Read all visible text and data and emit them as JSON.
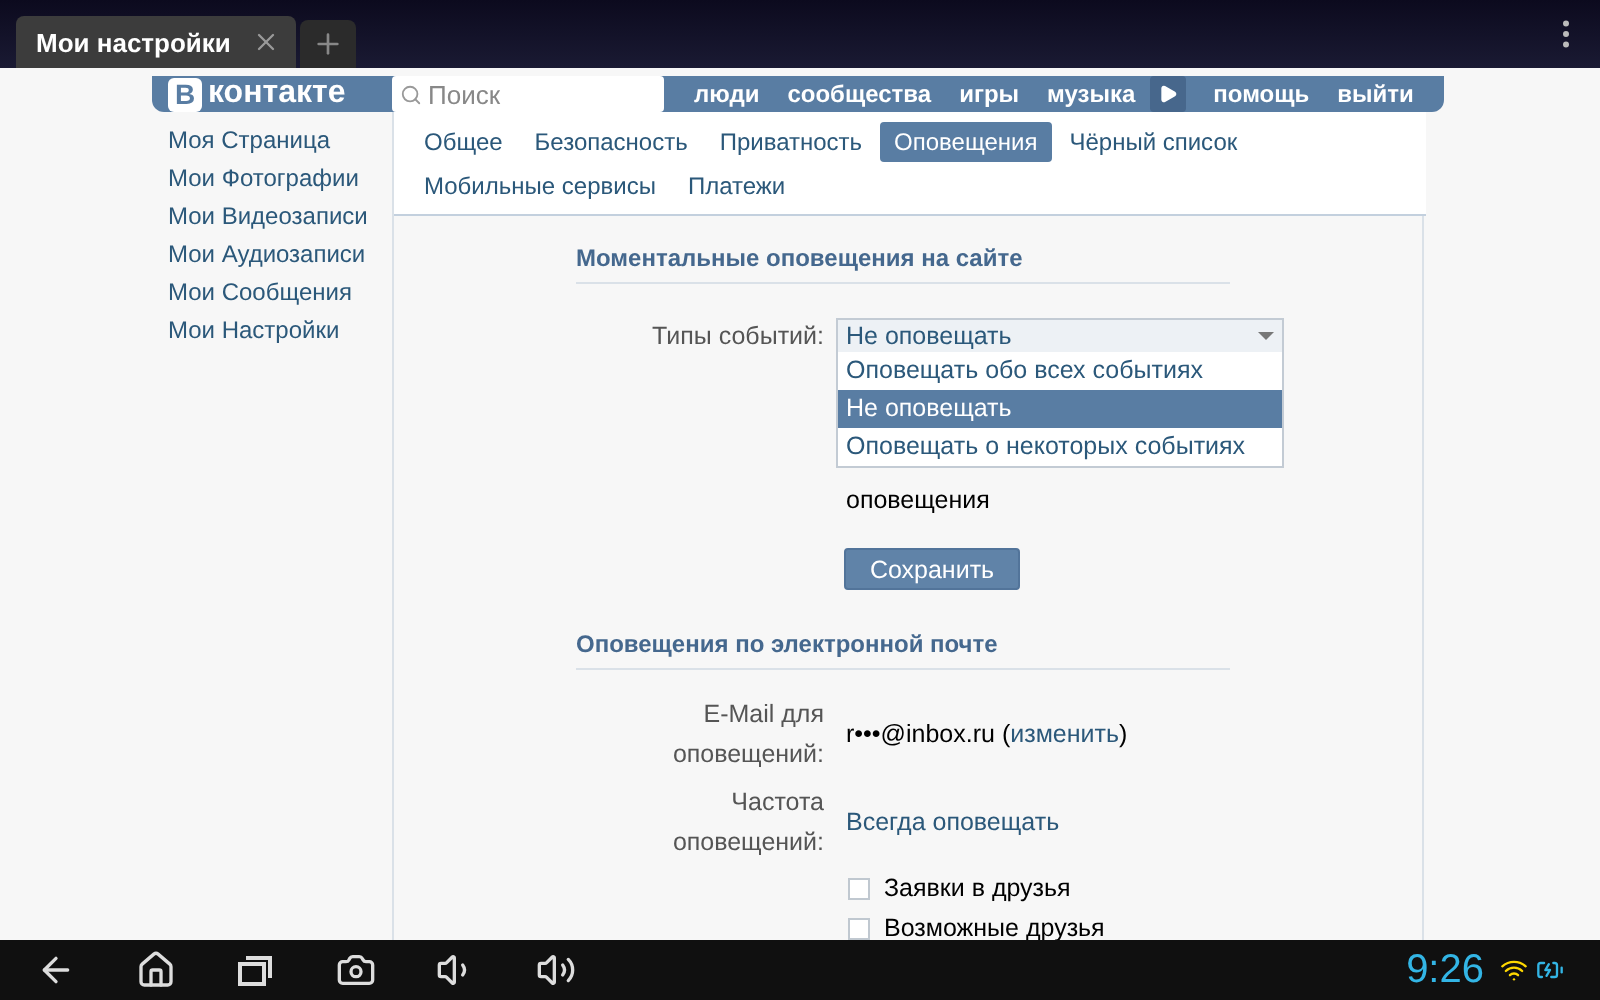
{
  "browser": {
    "tabs": [
      {
        "title": "Мои настройки",
        "selected": true
      }
    ]
  },
  "header": {
    "logo_letter": "В",
    "logo_text": "контакте",
    "search": {
      "placeholder": "Поиск"
    },
    "nav_left": [
      "люди",
      "сообщества",
      "игры",
      "музыка"
    ],
    "nav_right": [
      "помощь",
      "выйти"
    ]
  },
  "sidebar": {
    "items": [
      "Моя Страница",
      "Мои Фотографии",
      "Мои Видеозаписи",
      "Мои Аудиозаписи",
      "Мои Сообщения",
      "Мои Настройки"
    ]
  },
  "tabs": [
    {
      "label": "Общее",
      "selected": false
    },
    {
      "label": "Безопасность",
      "selected": false
    },
    {
      "label": "Приватность",
      "selected": false
    },
    {
      "label": "Оповещения",
      "selected": true
    },
    {
      "label": "Чёрный список",
      "selected": false
    },
    {
      "label": "Мобильные сервисы",
      "selected": false
    },
    {
      "label": "Платежи",
      "selected": false
    }
  ],
  "instant": {
    "title": "Моментальные оповещения на сайте",
    "label": "Типы событий:",
    "select": {
      "value": "Не оповещать",
      "expanded": true,
      "options": [
        {
          "label": "Оповещать обо всех событиях",
          "selected": false
        },
        {
          "label": "Не оповещать",
          "selected": true
        },
        {
          "label": "Оповещать о некоторых событиях",
          "selected": false
        }
      ]
    },
    "note": "оповещения",
    "save_button": "Сохранить"
  },
  "email": {
    "title": "Оповещения по электронной почте",
    "address_label": "E-Mail для оповещений:",
    "address": "r•••@inbox.ru",
    "paren_open": "(",
    "change_link": "изменить",
    "paren_close": ")",
    "frequency_label": "Частота оповещений:",
    "frequency": "Всегда оповещать",
    "checkboxes": [
      {
        "label": "Заявки в друзья",
        "checked": false
      },
      {
        "label": "Возможные друзья",
        "checked": false
      }
    ]
  },
  "system_bar": {
    "clock": "9:26"
  }
}
